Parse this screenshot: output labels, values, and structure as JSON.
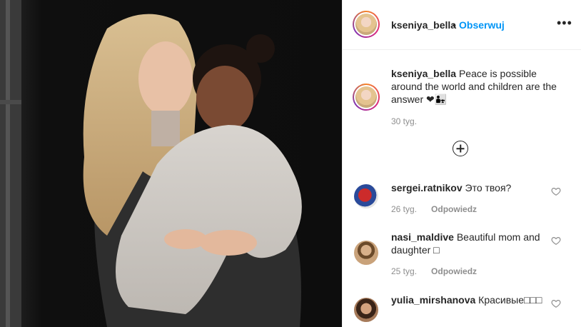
{
  "post": {
    "image_alt": "Photo of woman holding a child"
  },
  "header": {
    "username": "kseniya_bella",
    "separator": "•",
    "follow_label": "Obserwuj",
    "more_icon": "more-options-icon",
    "more_label": "•••"
  },
  "caption": {
    "username": "kseniya_bella",
    "text": "Peace is possible around the world and children are the answer",
    "emoji": "❤👨‍👧",
    "time": "30 tyg."
  },
  "load_more": {
    "icon": "plus-circle-icon"
  },
  "comments": [
    {
      "username": "sergei.ratnikov",
      "text": "Это твоя?",
      "time": "26 tyg.",
      "reply": "Odpowiedz"
    },
    {
      "username": "nasi_maldive",
      "text": "Beautiful mom and daughter □",
      "time": "25 tyg.",
      "reply": "Odpowiedz"
    },
    {
      "username": "yulia_mirshanova",
      "text": "Красивые□□□",
      "time": "",
      "reply": ""
    }
  ],
  "colors": {
    "link": "#0095f6",
    "meta": "#8e8e8e",
    "text": "#262626",
    "border": "#efefef"
  }
}
